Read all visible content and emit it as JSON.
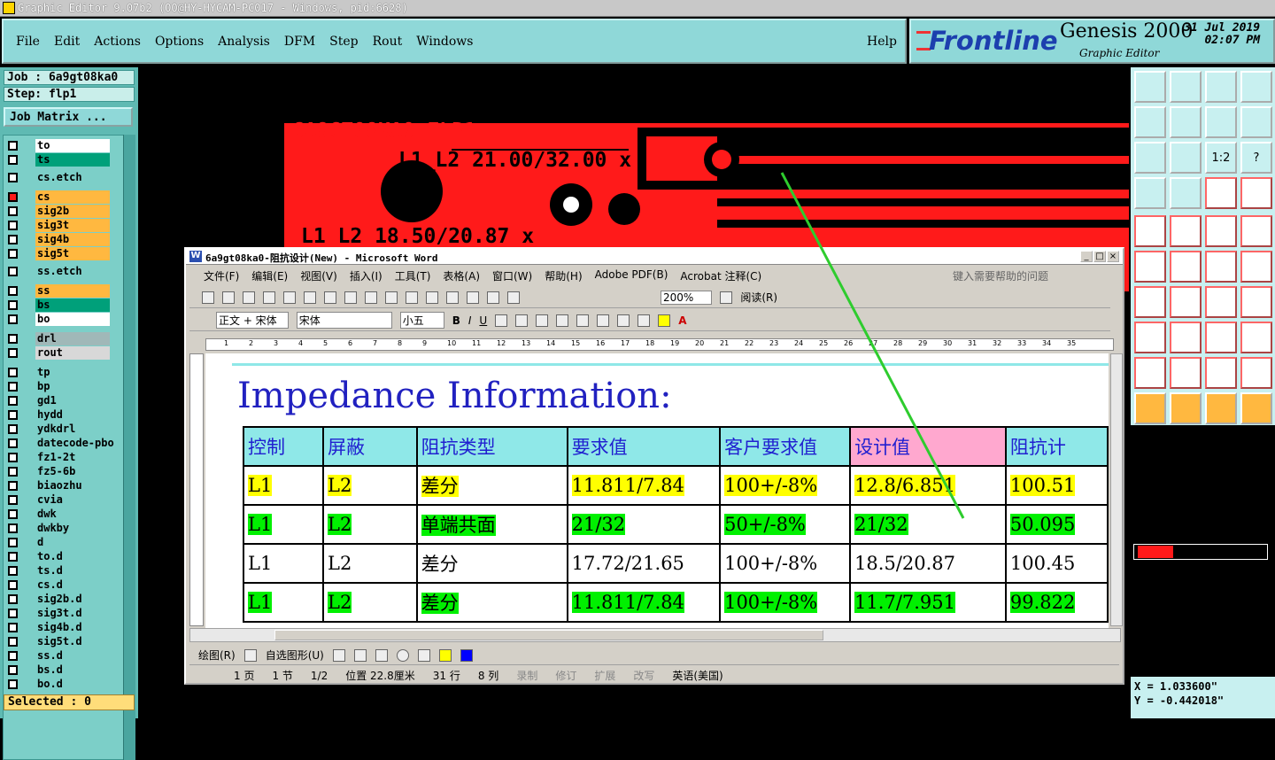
{
  "window_title": "Graphic Editor 9.07b2 (OO@HY-HYCAM-PC017 - Windows, pid:6628)",
  "menu": [
    "File",
    "Edit",
    "Actions",
    "Options",
    "Analysis",
    "DFM",
    "Step",
    "Rout",
    "Windows"
  ],
  "help": "Help",
  "brand": {
    "logo": "Frontline",
    "product": "Genesis 2000",
    "date": "31 Jul 2019",
    "time": "02:07 PM",
    "subtitle": "Graphic Editor"
  },
  "job": {
    "job": "Job : 6a9gt08ka0",
    "step": "Step: flp1",
    "matrix": "Job Matrix ..."
  },
  "layers": [
    {
      "name": "to",
      "color": "#ffffff"
    },
    {
      "name": "ts",
      "color": "#00a07a"
    },
    {
      "name": "cs.etch",
      "color": "#7ccfc8"
    },
    {
      "name": "cs",
      "color": "#ffb840"
    },
    {
      "name": "sig2b",
      "color": "#ffb840"
    },
    {
      "name": "sig3t",
      "color": "#ffb840"
    },
    {
      "name": "sig4b",
      "color": "#ffb840"
    },
    {
      "name": "sig5t",
      "color": "#ffb840"
    },
    {
      "name": "ss.etch",
      "color": "#7ccfc8"
    },
    {
      "name": "ss",
      "color": "#ffb840"
    },
    {
      "name": "bs",
      "color": "#00a07a"
    },
    {
      "name": "bo",
      "color": "#ffffff"
    },
    {
      "name": "drl",
      "color": "#a0b8b8"
    },
    {
      "name": "rout",
      "color": "#d8d8d8"
    },
    {
      "name": "tp",
      "color": "#7ccfc8"
    },
    {
      "name": "bp",
      "color": "#7ccfc8"
    },
    {
      "name": "gd1",
      "color": "#7ccfc8"
    },
    {
      "name": "hydd",
      "color": "#7ccfc8"
    },
    {
      "name": "ydkdrl",
      "color": "#7ccfc8"
    },
    {
      "name": "datecode-pbo",
      "color": "#7ccfc8"
    },
    {
      "name": "fz1-2t",
      "color": "#7ccfc8"
    },
    {
      "name": "fz5-6b",
      "color": "#7ccfc8"
    },
    {
      "name": "biaozhu",
      "color": "#7ccfc8"
    },
    {
      "name": "cvia",
      "color": "#7ccfc8"
    },
    {
      "name": "dwk",
      "color": "#7ccfc8"
    },
    {
      "name": "dwkby",
      "color": "#7ccfc8"
    },
    {
      "name": "d",
      "color": "#7ccfc8"
    },
    {
      "name": "to.d",
      "color": "#7ccfc8"
    },
    {
      "name": "ts.d",
      "color": "#7ccfc8"
    },
    {
      "name": "cs.d",
      "color": "#7ccfc8"
    },
    {
      "name": "sig2b.d",
      "color": "#7ccfc8"
    },
    {
      "name": "sig3t.d",
      "color": "#7ccfc8"
    },
    {
      "name": "sig4b.d",
      "color": "#7ccfc8"
    },
    {
      "name": "sig5t.d",
      "color": "#7ccfc8"
    },
    {
      "name": "ss.d",
      "color": "#7ccfc8"
    },
    {
      "name": "bs.d",
      "color": "#7ccfc8"
    },
    {
      "name": "bo.d",
      "color": "#7ccfc8"
    }
  ],
  "selected": "Selected : 0",
  "coords": {
    "x": "X =  1.033600\"",
    "y": "Y = -0.442018\""
  },
  "pcb": {
    "title": "6A9GT08KA0 FLP1",
    "label1": "L1_L2 21.00/32.00 x",
    "label2": "L1 L2 18.50/20.87 x"
  },
  "word": {
    "title": "6a9gt08ka0-阻抗设计(New) - Microsoft Word",
    "menu": [
      "文件(F)",
      "编辑(E)",
      "视图(V)",
      "插入(I)",
      "工具(T)",
      "表格(A)",
      "窗口(W)",
      "帮助(H)",
      "Adobe PDF(B)",
      "Acrobat 注释(C)"
    ],
    "help_placeholder": "键入需要帮助的问题",
    "zoom": "200%",
    "read": "阅读(R)",
    "style": "正文 + 宋体",
    "font": "宋体",
    "size": "小五",
    "heading": "Impedance Information:",
    "table_head": [
      "控制",
      "屏蔽",
      "阻抗类型",
      "要求值",
      "客户要求值",
      "设计值",
      "阻抗计"
    ],
    "rows": [
      {
        "hl": "y",
        "cells": [
          "L1",
          "L2",
          "差分",
          "11.811/7.84",
          "100+/-8%",
          "12.8/6.851",
          "100.51"
        ]
      },
      {
        "hl": "g",
        "cells": [
          "L1",
          "L2",
          "单端共面",
          "21/32",
          "50+/-8%",
          "21/32",
          "50.095"
        ]
      },
      {
        "hl": "",
        "cells": [
          "L1",
          "L2",
          "差分",
          "17.72/21.65",
          "100+/-8%",
          "18.5/20.87",
          "100.45"
        ]
      },
      {
        "hl": "g",
        "cells": [
          "L1",
          "L2",
          "差分",
          "11.811/7.84",
          "100+/-8%",
          "11.7/7.951",
          "99.822"
        ]
      }
    ],
    "drawbar": [
      "绘图(R)",
      "自选图形(U)"
    ],
    "status": {
      "page": "1 页",
      "section": "1 节",
      "pages": "1/2",
      "pos": "位置 22.8厘米",
      "line": "31 行",
      "col": "8 列",
      "rec": "录制",
      "trk": "修订",
      "ext": "扩展",
      "ovr": "改写",
      "lang": "英语(美国)"
    }
  }
}
